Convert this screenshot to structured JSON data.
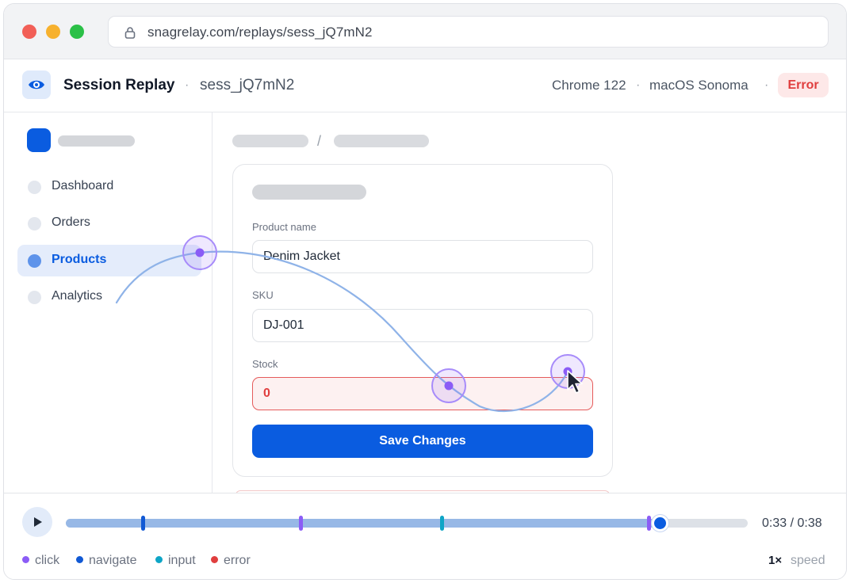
{
  "browser": {
    "url": "snagrelay.com/replays/sess_jQ7mN2"
  },
  "header": {
    "title": "Session Replay",
    "separator": "·",
    "session_id": "sess_jQ7mN2",
    "browser": "Chrome 122",
    "os": "macOS Sonoma",
    "status": "Error"
  },
  "sidebar": {
    "items": [
      {
        "label": "Dashboard",
        "active": false
      },
      {
        "label": "Orders",
        "active": false
      },
      {
        "label": "Products",
        "active": true
      },
      {
        "label": "Analytics",
        "active": false
      }
    ]
  },
  "breadcrumb": {
    "separator": "/"
  },
  "form": {
    "fields": [
      {
        "label": "Product name",
        "value": "Denim Jacket"
      },
      {
        "label": "SKU",
        "value": "DJ-001"
      },
      {
        "label": "Stock",
        "value": "0",
        "error": true
      }
    ],
    "submit_label": "Save Changes"
  },
  "player": {
    "current_time": "0:33",
    "total_time": "0:38",
    "time_separator": "/",
    "progress_fraction": 0.8735,
    "events": [
      {
        "type": "navigate",
        "position": 0.113
      },
      {
        "type": "click",
        "position": 0.345
      },
      {
        "type": "input",
        "position": 0.552
      },
      {
        "type": "click",
        "position": 0.855
      },
      {
        "type": "error",
        "position": 0.87
      }
    ],
    "legend": [
      {
        "label": "click",
        "type": "click"
      },
      {
        "label": "navigate",
        "type": "navigate"
      },
      {
        "label": "input",
        "type": "input"
      },
      {
        "label": "error",
        "type": "error"
      }
    ],
    "speed_value": "1×",
    "speed_label": "speed"
  },
  "colors": {
    "accent": "#0a5ce0",
    "click": "#8b5cf6",
    "navigate": "#1159d4",
    "input": "#0ea5c6",
    "error": "#e03e3e",
    "cursor_path": "#8fb3e8"
  },
  "icons": {
    "url_bar": "lock-icon",
    "app": "eye-icon",
    "player": "play-icon",
    "cursor": "cursor-arrow-icon"
  }
}
